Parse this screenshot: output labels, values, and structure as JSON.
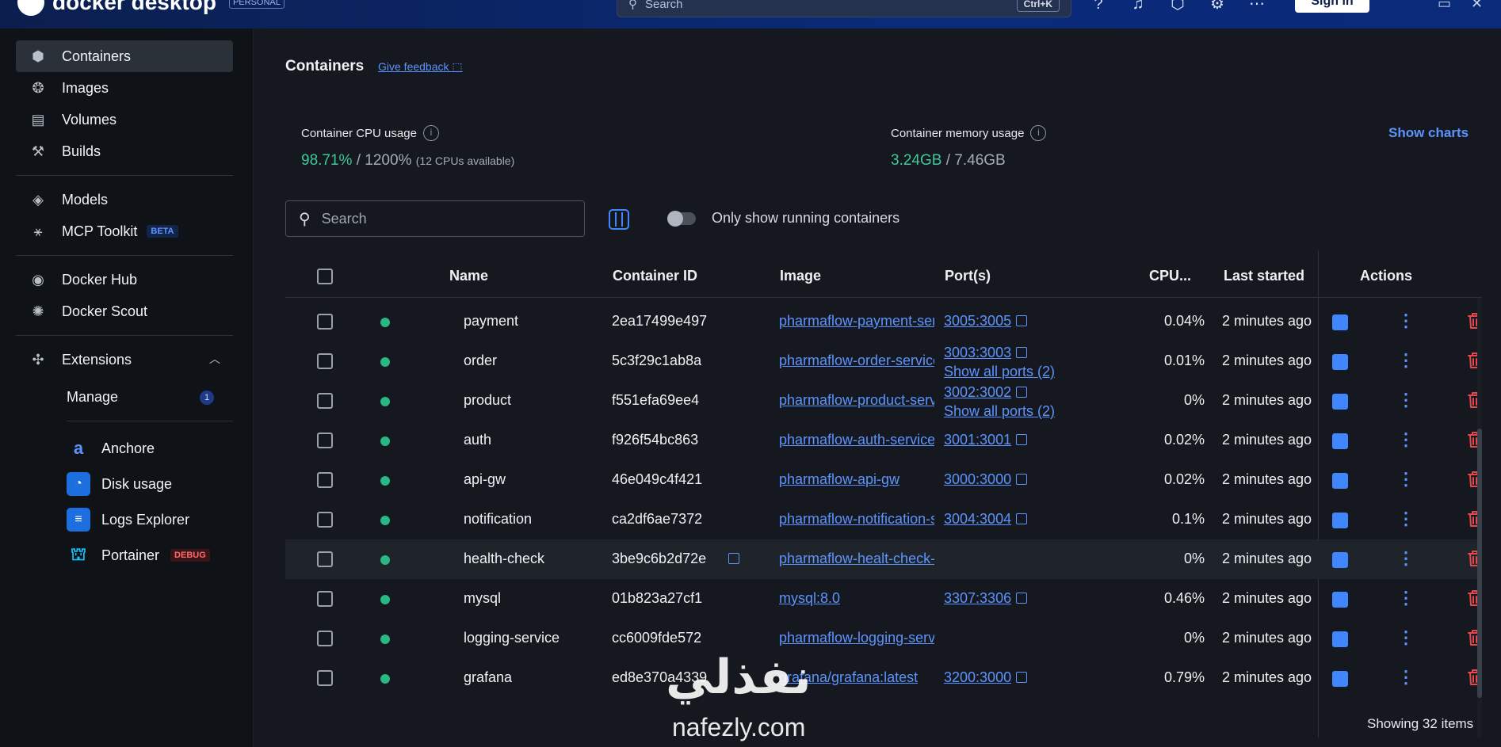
{
  "app": {
    "name": "docker desktop",
    "tier": "PERSONAL",
    "search_placeholder": "Search",
    "search_shortcut": "Ctrl+K",
    "sign_in": "Sign in"
  },
  "sidebar": {
    "items": [
      {
        "label": "Containers",
        "icon": "cube-icon"
      },
      {
        "label": "Images",
        "icon": "image-stack-icon"
      },
      {
        "label": "Volumes",
        "icon": "database-icon"
      },
      {
        "label": "Builds",
        "icon": "wrench-icon"
      },
      {
        "label": "Models",
        "icon": "model-cube-icon"
      },
      {
        "label": "MCP Toolkit",
        "icon": "toolkit-icon",
        "badge": "BETA"
      },
      {
        "label": "Docker Hub",
        "icon": "hub-icon"
      },
      {
        "label": "Docker Scout",
        "icon": "scout-icon"
      }
    ],
    "extensions": {
      "label": "Extensions",
      "manage": "Manage",
      "manage_count": "1",
      "items": [
        {
          "label": "Anchore",
          "color": "#1a2f6b"
        },
        {
          "label": "Disk usage",
          "color": "#1d6fe0"
        },
        {
          "label": "Logs Explorer",
          "color": "#1d6fe0"
        },
        {
          "label": "Portainer",
          "color": "#13bef9",
          "badge": "DEBUG"
        }
      ]
    }
  },
  "main": {
    "title": "Containers",
    "feedback": "Give feedback",
    "cpu_label": "Container CPU usage",
    "cpu_used": "98.71%",
    "cpu_total": "/ 1200%",
    "cpu_note": "(12 CPUs available)",
    "mem_label": "Container memory usage",
    "mem_used": "3.24GB",
    "mem_total": "/ 7.46GB",
    "show_charts": "Show charts",
    "search_placeholder": "Search",
    "running_toggle": "Only show running containers",
    "columns": {
      "name": "Name",
      "id": "Container ID",
      "image": "Image",
      "ports": "Port(s)",
      "cpu": "CPU...",
      "last": "Last started",
      "actions": "Actions"
    },
    "rows": [
      {
        "name": "payment",
        "id": "2ea17499e497",
        "image": "pharmaflow-payment-service",
        "port": "3005:3005",
        "port2": "",
        "cpu": "0.04%",
        "last": "2 minutes ago"
      },
      {
        "name": "order",
        "id": "5c3f29c1ab8a",
        "image": "pharmaflow-order-service",
        "port": "3003:3003",
        "port2": "Show all ports (2)",
        "cpu": "0.01%",
        "last": "2 minutes ago"
      },
      {
        "name": "product",
        "id": "f551efa69ee4",
        "image": "pharmaflow-product-service",
        "port": "3002:3002",
        "port2": "Show all ports (2)",
        "cpu": "0%",
        "last": "2 minutes ago"
      },
      {
        "name": "auth",
        "id": "f926f54bc863",
        "image": "pharmaflow-auth-service",
        "port": "3001:3001",
        "port2": "",
        "cpu": "0.02%",
        "last": "2 minutes ago"
      },
      {
        "name": "api-gw",
        "id": "46e049c4f421",
        "image": "pharmaflow-api-gw",
        "port": "3000:3000",
        "port2": "",
        "cpu": "0.02%",
        "last": "2 minutes ago"
      },
      {
        "name": "notification",
        "id": "ca2df6ae7372",
        "image": "pharmaflow-notification-service",
        "port": "3004:3004",
        "port2": "",
        "cpu": "0.1%",
        "last": "2 minutes ago"
      },
      {
        "name": "health-check",
        "id": "3be9c6b2d72e",
        "image": "pharmaflow-healt-check-service",
        "port": "",
        "port2": "",
        "cpu": "0%",
        "last": "2 minutes ago"
      },
      {
        "name": "mysql",
        "id": "01b823a27cf1",
        "image": "mysql:8.0",
        "port": "3307:3306",
        "port2": "",
        "cpu": "0.46%",
        "last": "2 minutes ago"
      },
      {
        "name": "logging-service",
        "id": "cc6009fde572",
        "image": "pharmaflow-logging-service",
        "port": "",
        "port2": "",
        "cpu": "0%",
        "last": "2 minutes ago"
      },
      {
        "name": "grafana",
        "id": "ed8e370a4339",
        "image": "grafana/grafana:latest",
        "port": "3200:3000",
        "port2": "",
        "cpu": "0.79%",
        "last": "2 minutes ago"
      }
    ],
    "footer": "Showing 32 items"
  },
  "watermark": {
    "arabic": "نفذلي",
    "latin": "nafezly.com"
  },
  "colors": {
    "accent": "#3f86ff",
    "running": "#29b884",
    "danger": "#e5484d"
  }
}
